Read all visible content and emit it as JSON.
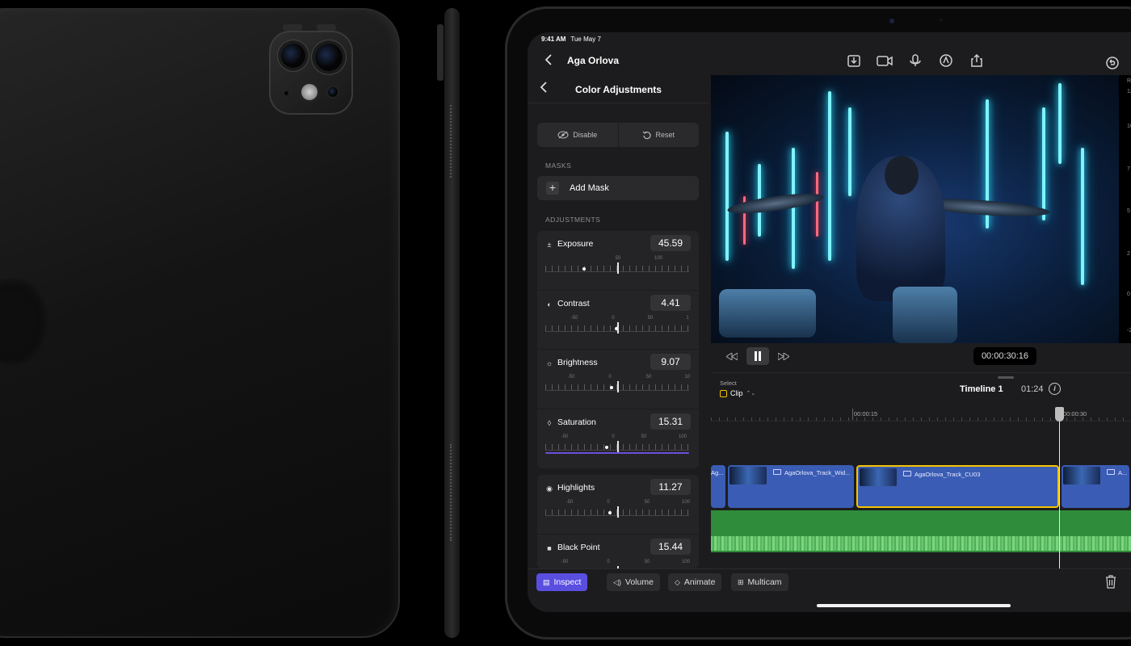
{
  "status_bar": {
    "time": "9:41 AM",
    "date": "Tue May 7"
  },
  "header": {
    "project_title": "Aga Orlova",
    "icons": [
      "import-icon",
      "camera-icon",
      "microphone-icon",
      "pencil-icon",
      "share-icon",
      "undo-icon"
    ]
  },
  "inspector": {
    "title": "Color Adjustments",
    "disable_label": "Disable",
    "reset_label": "Reset",
    "masks_heading": "MASKS",
    "add_mask_label": "Add Mask",
    "adjustments_heading": "ADJUSTMENTS",
    "adjustments": [
      {
        "name": "Exposure",
        "value": "45.59",
        "ticks": [
          "",
          "50",
          "100"
        ],
        "icon": "exposure-icon"
      },
      {
        "name": "Contrast",
        "value": "4.41",
        "ticks": [
          "-50",
          "0",
          "50",
          "1"
        ],
        "icon": "contrast-icon"
      },
      {
        "name": "Brightness",
        "value": "9.07",
        "ticks": [
          "-50",
          "0",
          "50",
          "10"
        ],
        "icon": "sun-icon"
      },
      {
        "name": "Saturation",
        "value": "15.31",
        "ticks": [
          "-50",
          "0",
          "50",
          "100"
        ],
        "icon": "drop-icon"
      },
      {
        "name": "Highlights",
        "value": "11.27",
        "ticks": [
          "-50",
          "0",
          "50",
          "100"
        ],
        "icon": "highlights-icon"
      },
      {
        "name": "Black Point",
        "value": "15.44",
        "ticks": [
          "-50",
          "0",
          "50",
          "100"
        ],
        "icon": "black-point-icon"
      }
    ]
  },
  "viewer": {
    "scale_labels": [
      "R",
      "12",
      "10",
      "7",
      "5",
      "2",
      "0",
      "-2"
    ],
    "timecode": "00:00:30:16"
  },
  "timeline": {
    "select_label": "Select",
    "mode_label": "Clip",
    "name": "Timeline 1",
    "duration": "01:24",
    "ruler_labels": [
      "00:00:15",
      "00:00:30"
    ],
    "clips": [
      {
        "label": "Ag..."
      },
      {
        "label": "AgaOrlova_Track_Wid..."
      },
      {
        "label": "AgaOrlova_Track_CU03"
      },
      {
        "label": "A..."
      }
    ]
  },
  "bottom_bar": {
    "inspect_label": "Inspect",
    "volume_label": "Volume",
    "animate_label": "Animate",
    "multicam_label": "Multicam"
  },
  "colors": {
    "accent": "#5a4ee0",
    "clip_blue": "#3a5cb4",
    "audio_green": "#2f8c3a",
    "selection_yellow": "#f5c400",
    "saturation_bar": "#6b4fd8"
  }
}
